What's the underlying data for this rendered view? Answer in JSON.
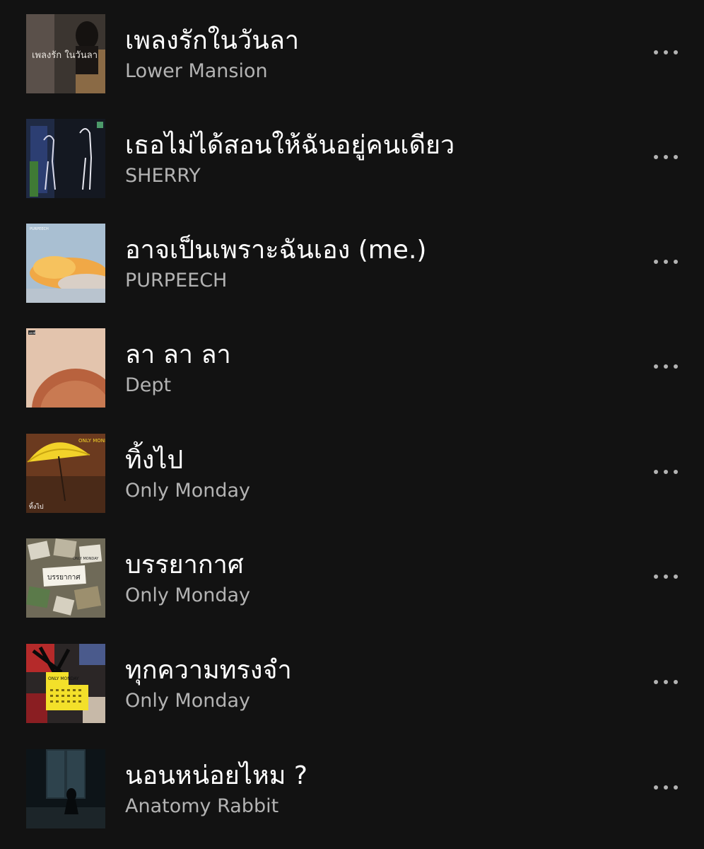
{
  "tracks": [
    {
      "title": "เพลงรักในวันลา",
      "artist": "Lower Mansion",
      "cover_text": "เพลงรัก ในวันลา"
    },
    {
      "title": "เธอไม่ได้สอนให้ฉันอยู่คนเดียว",
      "artist": "SHERRY"
    },
    {
      "title": "อาจเป็นเพราะฉันเอง (me.)",
      "artist": "PURPEECH",
      "cover_text": "PURPEECH"
    },
    {
      "title": "ลา ลา ลา",
      "artist": "Dept",
      "cover_text": "เดปท์"
    },
    {
      "title": "ทิ้งไป",
      "artist": "Only Monday",
      "cover_text": "ONLY MONDAY",
      "cover_text2": "ทิ้งไป"
    },
    {
      "title": "บรรยากาศ",
      "artist": "Only Monday",
      "cover_text": "บรรยากาศ",
      "cover_text2": "ONLY MONDAY"
    },
    {
      "title": "ทุกความทรงจำ",
      "artist": "Only Monday",
      "cover_text": "ONLY MONDAY"
    },
    {
      "title": "นอนหน่อยไหม ?",
      "artist": "Anatomy Rabbit"
    }
  ],
  "colors": {
    "background": "#121212",
    "title": "#ffffff",
    "artist": "#b3b3b3",
    "more_icon": "#b3b3b3"
  },
  "icons": {
    "more": "more-horizontal-icon"
  }
}
